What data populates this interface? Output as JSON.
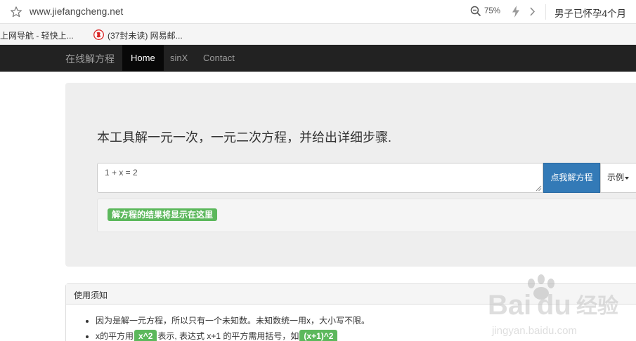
{
  "browser": {
    "url": "www.jiefangcheng.net",
    "zoom": "75%",
    "news_text": "男子已怀孕4个月",
    "bookmarks": [
      {
        "label": "上网导航 - 轻快上..."
      },
      {
        "label": "(37封未读) 网易邮..."
      }
    ]
  },
  "navbar": {
    "brand": "在线解方程",
    "items": [
      {
        "label": "Home",
        "active": true
      },
      {
        "label": "sinX",
        "active": false
      },
      {
        "label": "Contact",
        "active": false
      }
    ]
  },
  "jumbotron": {
    "lead": "本工具解一元一次，一元二次方程，并给出详细步骤.",
    "equation_value": "1 + x = 2",
    "solve_label": "点我解方程",
    "example_label": "示例",
    "result_placeholder": "解方程的结果将显示在这里"
  },
  "usage": {
    "title": "使用须知",
    "item1": "因为是解一元方程，所以只有一个未知数。未知数统一用x，大小写不限。",
    "item2_pre": "x的平方用",
    "item2_code1": "x^2",
    "item2_mid": "表示, 表达式 x+1 的平方需用括号，如",
    "item2_code2": "(x+1)^2"
  },
  "watermark": {
    "brand": "Bai du 经验",
    "url": "jingyan.baidu.com"
  },
  "colors": {
    "navbar_bg": "#222222",
    "primary": "#337ab7",
    "success": "#5cb85c",
    "jumbotron_bg": "#eeeeee"
  }
}
